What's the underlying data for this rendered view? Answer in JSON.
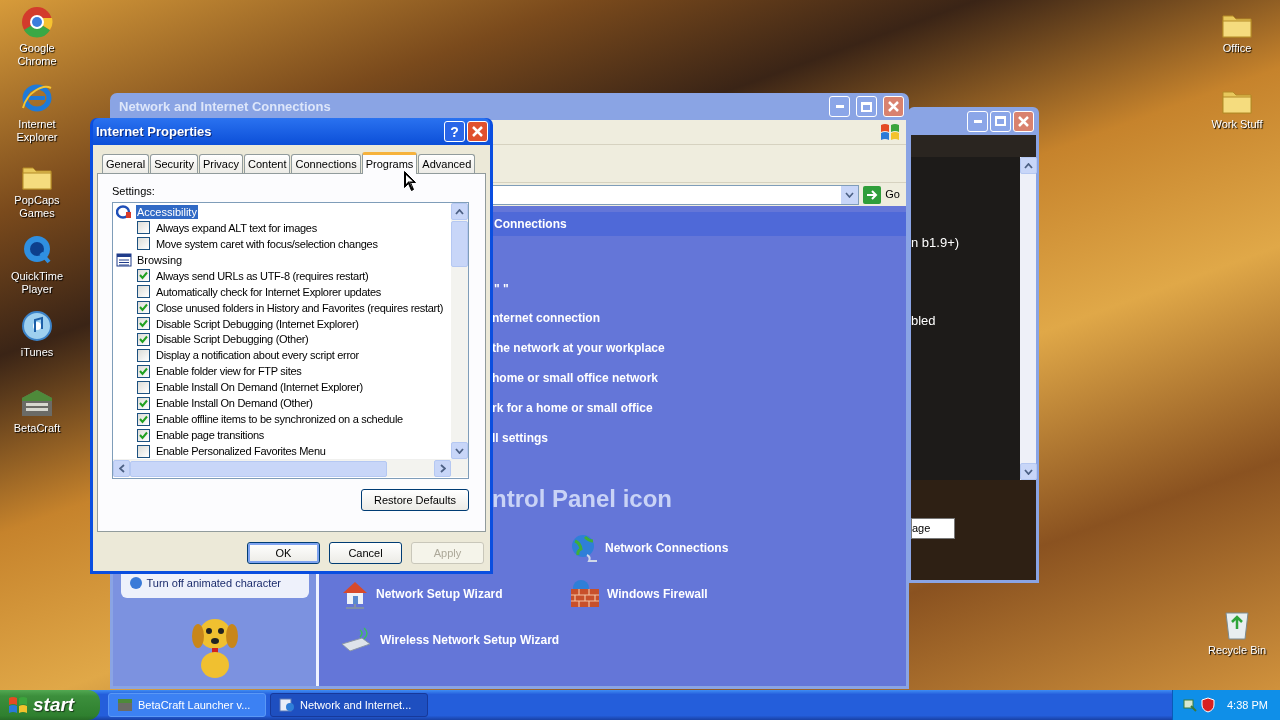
{
  "desktop": {
    "left_icons": [
      {
        "label": "Google Chrome",
        "kind": "chrome"
      },
      {
        "label": "Internet Explorer",
        "kind": "ie"
      },
      {
        "label": "PopCaps Games",
        "kind": "folder"
      },
      {
        "label": "QuickTime Player",
        "kind": "quicktime"
      },
      {
        "label": "iTunes",
        "kind": "itunes"
      },
      {
        "label": "BetaCraft",
        "kind": "betacraft"
      }
    ],
    "right_top_icons": [
      {
        "label": "Office",
        "kind": "folder"
      },
      {
        "label": "Work Stuff",
        "kind": "folder"
      }
    ],
    "right_bottom_icons": [
      {
        "label": "Recycle Bin",
        "kind": "recycle"
      }
    ]
  },
  "back_window": {
    "lines": [
      "n b1.9+)",
      "bled"
    ],
    "button": "age"
  },
  "connections_window": {
    "title": "Network and Internet Connections",
    "go_button": "Go",
    "header": "Connections",
    "fragment": "\" \"",
    "tasks": [
      "nternet connection",
      "the network at your workplace",
      "home or small office network",
      "rk for a home or small office",
      "ll settings"
    ],
    "pick_heading": "ntrol Panel icon",
    "icons": [
      {
        "label": "Network Connections",
        "kind": "connections"
      },
      {
        "label": "Network Setup Wizard",
        "kind": "setup"
      },
      {
        "label": "Windows Firewall",
        "kind": "firewall"
      },
      {
        "label": "Wireless Network Setup Wizard",
        "kind": "wireless"
      }
    ],
    "assistant_link": "Turn off animated character"
  },
  "dialog": {
    "title": "Internet Properties",
    "help_button": "?",
    "tabs": [
      {
        "label": "General",
        "selected": false
      },
      {
        "label": "Security",
        "selected": false
      },
      {
        "label": "Privacy",
        "selected": false
      },
      {
        "label": "Content",
        "selected": false
      },
      {
        "label": "Connections",
        "selected": false
      },
      {
        "label": "Programs",
        "selected": true
      },
      {
        "label": "Advanced",
        "selected": false
      }
    ],
    "settings_label": "Settings:",
    "settings": [
      {
        "label": "Accessibility",
        "selected": true,
        "children": [
          {
            "label": "Always expand ALT text for images",
            "checked": false
          },
          {
            "label": "Move system caret with focus/selection changes",
            "checked": false
          }
        ]
      },
      {
        "label": "Browsing",
        "selected": false,
        "children": [
          {
            "label": "Always send URLs as UTF-8 (requires restart)",
            "checked": true
          },
          {
            "label": "Automatically check for Internet Explorer updates",
            "checked": false
          },
          {
            "label": "Close unused folders in History and Favorites (requires restart)",
            "checked": true
          },
          {
            "label": "Disable Script Debugging (Internet Explorer)",
            "checked": true
          },
          {
            "label": "Disable Script Debugging (Other)",
            "checked": true
          },
          {
            "label": "Display a notification about every script error",
            "checked": false
          },
          {
            "label": "Enable folder view for FTP sites",
            "checked": true
          },
          {
            "label": "Enable Install On Demand (Internet Explorer)",
            "checked": false
          },
          {
            "label": "Enable Install On Demand (Other)",
            "checked": true
          },
          {
            "label": "Enable offline items to be synchronized on a schedule",
            "checked": true
          },
          {
            "label": "Enable page transitions",
            "checked": true
          },
          {
            "label": "Enable Personalized Favorites Menu",
            "checked": false
          }
        ]
      }
    ],
    "restore_button": "Restore Defaults",
    "buttons": [
      {
        "label": "OK",
        "default": true,
        "disabled": false
      },
      {
        "label": "Cancel",
        "default": false,
        "disabled": false
      },
      {
        "label": "Apply",
        "default": false,
        "disabled": true
      }
    ]
  },
  "taskbar": {
    "start": "start",
    "tasks": [
      {
        "label": "BetaCraft Launcher v...",
        "kind": "launcher",
        "selected": false
      },
      {
        "label": "Network and Internet...",
        "kind": "explorer",
        "selected": true
      }
    ],
    "clock": "4:38 PM"
  }
}
